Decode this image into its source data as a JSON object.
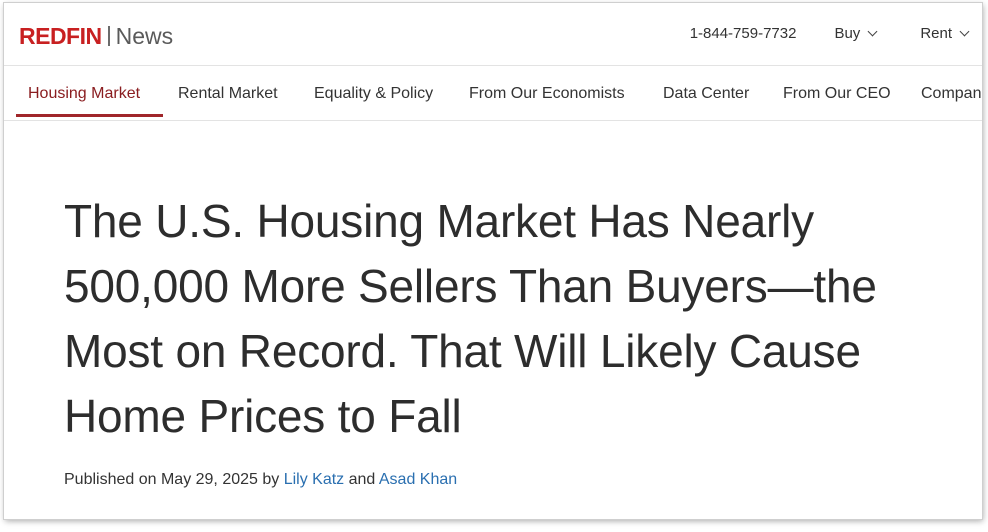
{
  "header": {
    "logo_brand": "REDFIN",
    "logo_section": "News",
    "phone": "1-844-759-7732",
    "menu": [
      {
        "label": "Buy"
      },
      {
        "label": "Rent"
      }
    ]
  },
  "nav": {
    "items": [
      {
        "label": "Housing Market",
        "active": true
      },
      {
        "label": "Rental Market"
      },
      {
        "label": "Equality & Policy"
      },
      {
        "label": "From Our Economists"
      },
      {
        "label": "Data Center"
      },
      {
        "label": "From Our CEO"
      },
      {
        "label": "Compan"
      }
    ]
  },
  "article": {
    "title": "The U.S. Housing Market Has Nearly 500,000 More Sellers Than Buyers—the Most on Record. That Will Likely Cause Home Prices to Fall",
    "byline": {
      "prefix": "Published on May 29, 2025 by ",
      "author1": "Lily Katz",
      "conjunction": " and ",
      "author2": "Asad Khan"
    }
  },
  "colors": {
    "brand_red": "#c82021",
    "active_nav": "#8a1d20",
    "link_blue": "#2a6fb0"
  }
}
